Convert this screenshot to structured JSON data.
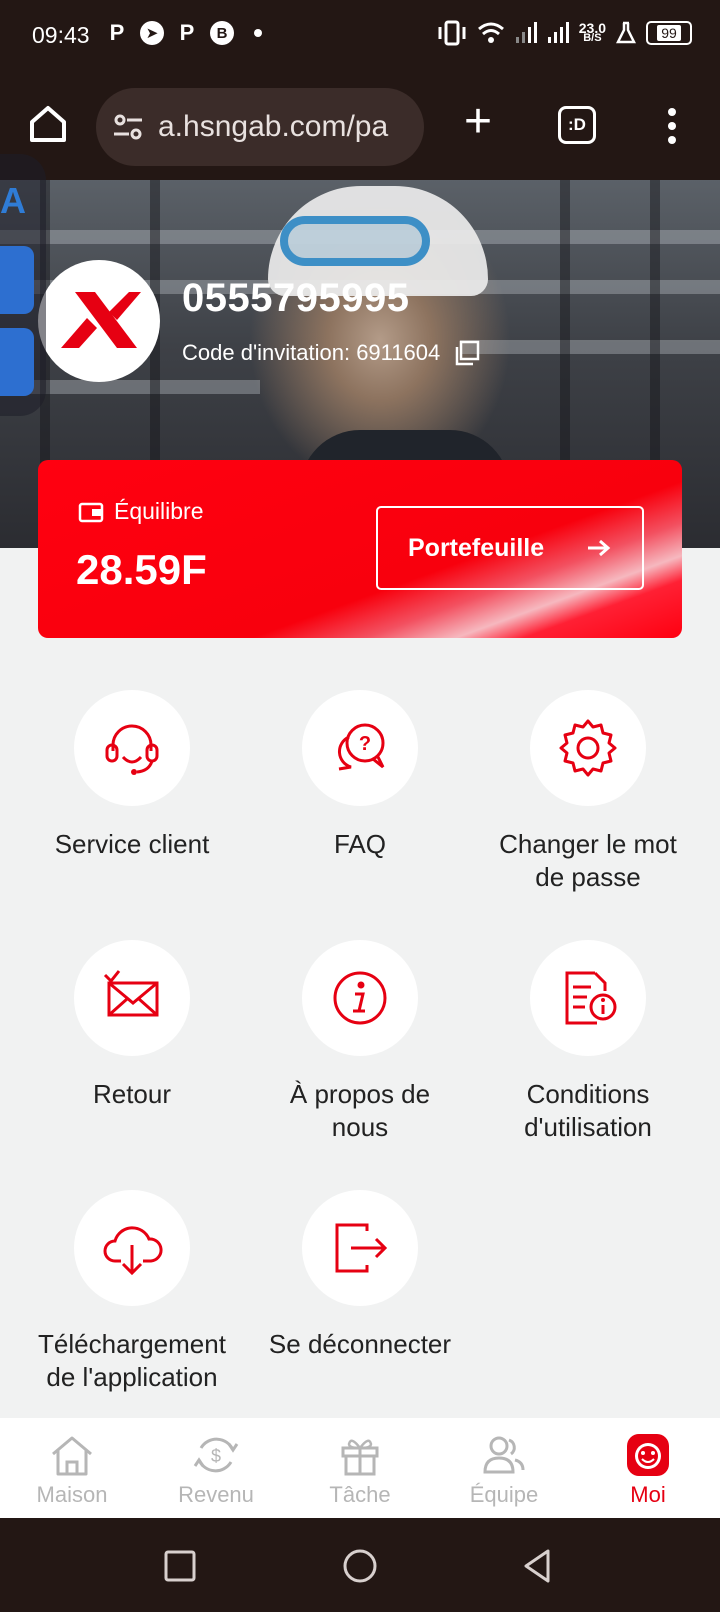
{
  "status_bar": {
    "time": "09:43",
    "notification_icons": [
      "P",
      "telegram-icon",
      "P",
      "B"
    ],
    "speed_value": "23.0",
    "speed_unit": "B/S",
    "battery": "99"
  },
  "browser": {
    "url": "a.hsngab.com/pa",
    "tabs_label": ":D"
  },
  "profile": {
    "phone": "0555795995",
    "invitation_label": "Code d'invitation: 6911604"
  },
  "balance": {
    "label": "Équilibre",
    "value": "28.59F",
    "wallet_button": "Portefeuille"
  },
  "menu": {
    "items": [
      {
        "label": "Service client",
        "icon": "headset-icon"
      },
      {
        "label": "FAQ",
        "icon": "faq-icon"
      },
      {
        "label": "Changer le mot de passe",
        "icon": "gear-icon"
      },
      {
        "label": "Retour",
        "icon": "mail-icon"
      },
      {
        "label": "À propos de nous",
        "icon": "info-icon"
      },
      {
        "label": "Conditions d'utilisation",
        "icon": "document-icon"
      },
      {
        "label": "Téléchargement de l'application",
        "icon": "cloud-download-icon"
      },
      {
        "label": "Se déconnecter",
        "icon": "logout-icon"
      }
    ]
  },
  "bottom_nav": {
    "items": [
      {
        "label": "Maison",
        "icon": "home-icon"
      },
      {
        "label": "Revenu",
        "icon": "revenue-icon"
      },
      {
        "label": "Tâche",
        "icon": "gift-icon"
      },
      {
        "label": "Équipe",
        "icon": "team-icon"
      },
      {
        "label": "Moi",
        "icon": "me-icon"
      }
    ],
    "active": "Moi"
  },
  "colors": {
    "accent": "#e60012",
    "status_bar": "#231714",
    "background": "#f1f2f2",
    "inactive_nav": "#b6b6b6"
  }
}
